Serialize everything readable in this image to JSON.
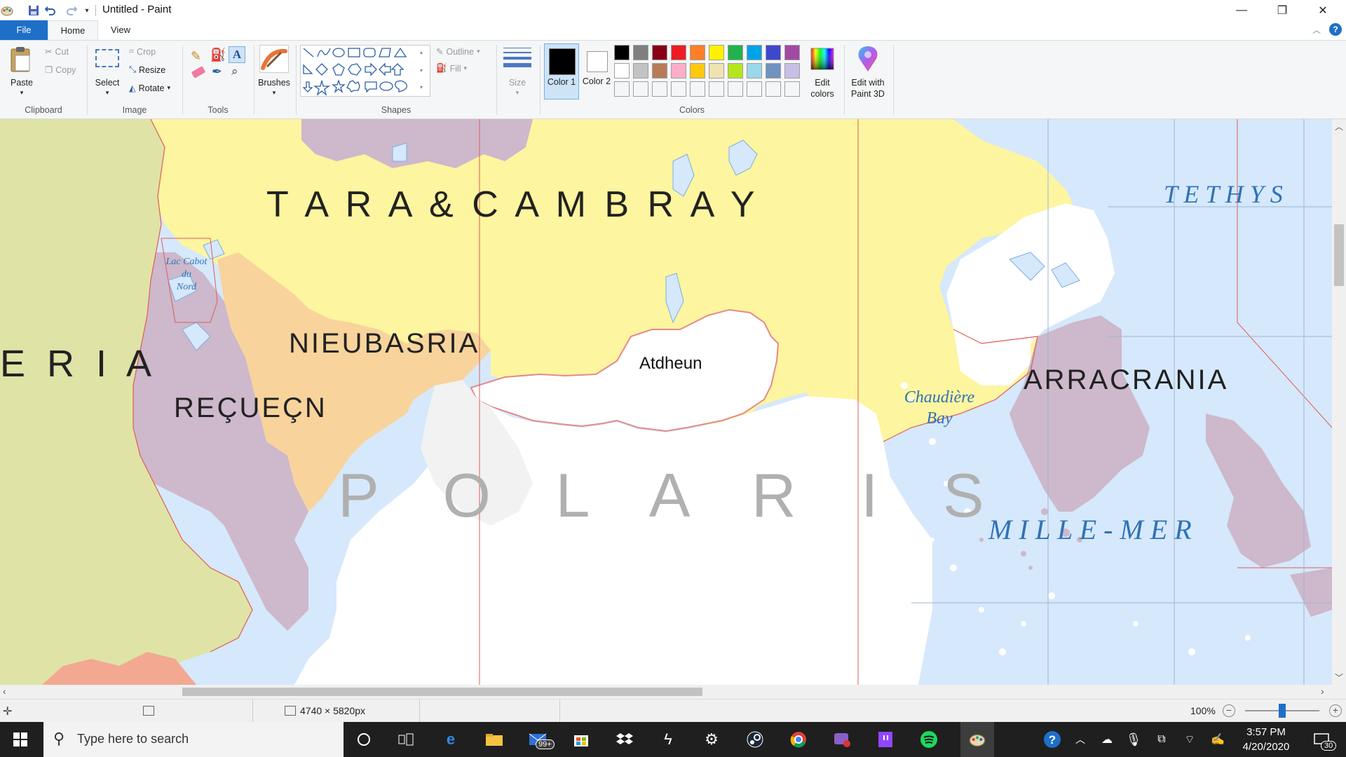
{
  "window": {
    "title": "Untitled - Paint",
    "controls": {
      "minimize": "—",
      "maximize": "❐",
      "close": "✕"
    }
  },
  "tabs": {
    "file": "File",
    "home": "Home",
    "view": "View"
  },
  "ribbon": {
    "clipboard": {
      "paste": "Paste",
      "cut": "Cut",
      "copy": "Copy",
      "group": "Clipboard"
    },
    "image": {
      "select": "Select",
      "crop": "Crop",
      "resize": "Resize",
      "rotate": "Rotate",
      "group": "Image"
    },
    "tools": {
      "group": "Tools"
    },
    "brushes": {
      "label": "Brushes"
    },
    "shapes": {
      "outline": "Outline",
      "fill": "Fill",
      "group": "Shapes"
    },
    "size": {
      "label": "Size"
    },
    "colors": {
      "color1": "Color 1",
      "color2": "Color 2",
      "edit_colors": "Edit colors",
      "group": "Colors",
      "palette_row1": [
        "#000000",
        "#7f7f7f",
        "#880015",
        "#ed1c24",
        "#ff7f27",
        "#fff200",
        "#22b14c",
        "#00a2e8",
        "#3f48cc",
        "#a349a4"
      ],
      "palette_row2": [
        "#ffffff",
        "#c3c3c3",
        "#b97a57",
        "#ffaec9",
        "#ffc90e",
        "#efe4b0",
        "#b5e61d",
        "#99d9ea",
        "#7092be",
        "#c8bfe7"
      ],
      "color1_value": "#000000",
      "color2_value": "#ffffff"
    },
    "paint3d": {
      "label": "Edit with Paint 3D"
    }
  },
  "map": {
    "labels": {
      "tara": "T A R A   &   C A M B R A Y",
      "tethys": "T E T H Y S",
      "lac_line1": "Lac Cabot",
      "lac_line2": "du",
      "lac_line3": "Nord",
      "nieubasria": "NIEUBASRIA",
      "atdheun": "Atdheun",
      "eria": "E R I A",
      "arracrania": "ARRACRANIA",
      "chaudiere_line1": "Chaudière",
      "chaudiere_line2": "Bay",
      "recuecn": "REÇUEÇN",
      "polaris": "P O L A R I S",
      "millemer": "M I L L E - M E R"
    },
    "colors": {
      "sea": "#d6e8fb",
      "tara": "#fdf59f",
      "purple": "#cdb8cc",
      "orange": "#f8d49c",
      "green": "#dfe3a6",
      "white": "#ffffff",
      "grey": "#f2f2f2",
      "salmon": "#f3a892",
      "border_red": "#e05b5b",
      "sea_text": "#2f72b8"
    }
  },
  "status": {
    "image_size": "4740 × 5820px",
    "zoom": "100%"
  },
  "taskbar": {
    "search_placeholder": "Type here to search",
    "time": "3:57 PM",
    "date": "4/20/2020",
    "mail_badge": "99+",
    "notification_count": "30"
  }
}
